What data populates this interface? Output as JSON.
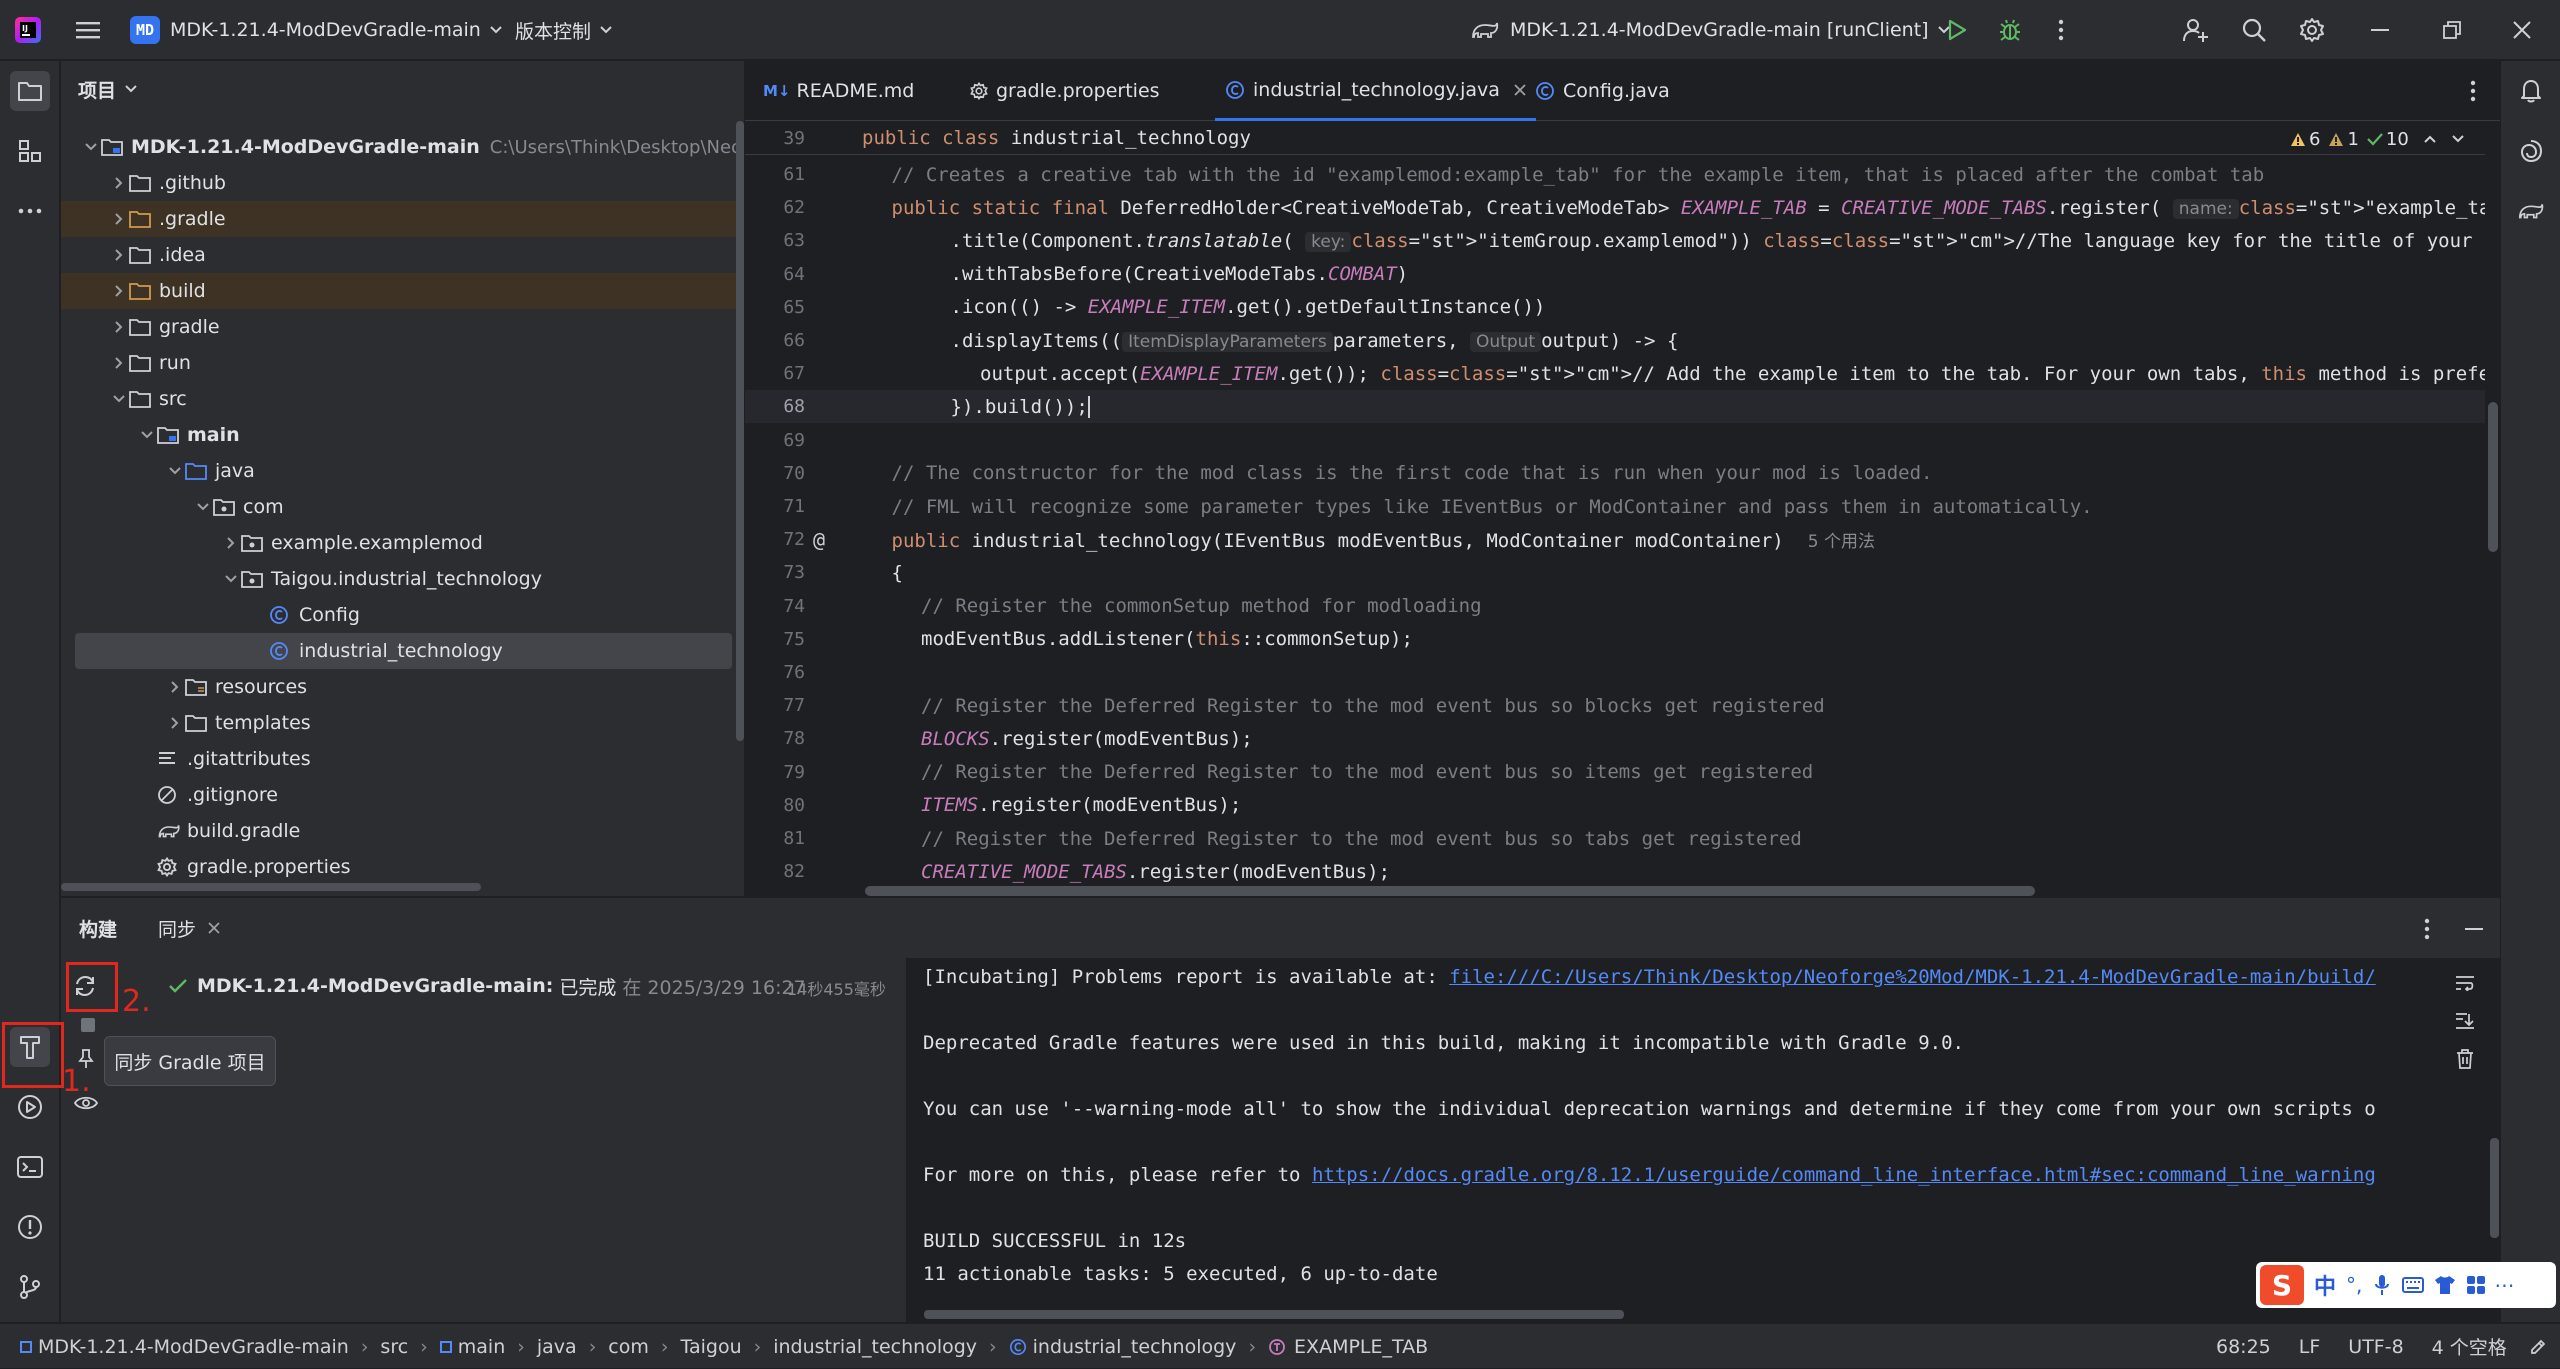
{
  "titlebar": {
    "project_badge": "MD",
    "project_name": "MDK-1.21.4-ModDevGradle-main",
    "vcs_label": "版本控制",
    "run_config": "MDK-1.21.4-ModDevGradle-main [runClient]"
  },
  "project_panel": {
    "header": "项目",
    "root_name": "MDK-1.21.4-ModDevGradle-main",
    "root_path": "C:\\Users\\Think\\Desktop\\Neoforge",
    "items": [
      {
        "label": ".github"
      },
      {
        "label": ".gradle"
      },
      {
        "label": ".idea"
      },
      {
        "label": "build"
      },
      {
        "label": "gradle"
      },
      {
        "label": "run"
      },
      {
        "label": "src"
      },
      {
        "label": "main"
      },
      {
        "label": "java"
      },
      {
        "label": "com"
      },
      {
        "label": "example.examplemod"
      },
      {
        "label": "Taigou.industrial_technology"
      },
      {
        "label": "Config"
      },
      {
        "label": "industrial_technology"
      },
      {
        "label": "resources"
      },
      {
        "label": "templates"
      },
      {
        "label": ".gitattributes"
      },
      {
        "label": ".gitignore"
      },
      {
        "label": "build.gradle"
      },
      {
        "label": "gradle.properties"
      }
    ]
  },
  "editor": {
    "tabs": [
      {
        "label": "README.md",
        "icon": "markdown-icon"
      },
      {
        "label": "gradle.properties",
        "icon": "gear-icon"
      },
      {
        "label": "industrial_technology.java",
        "icon": "class-icon"
      },
      {
        "label": "Config.java",
        "icon": "class-icon"
      }
    ],
    "sticky_line": {
      "num": "39",
      "text": "public class industrial_technology"
    },
    "inspections": {
      "warnings": "6",
      "weak_warnings": "1",
      "ok": "10"
    },
    "lines": [
      {
        "num": "61",
        "text": "// Creates a creative tab with the id \"examplemod:example_tab\" for the example item, that is placed after the combat tab"
      },
      {
        "num": "62",
        "text": "public static final DeferredHolder<CreativeModeTab, CreativeModeTab> EXAMPLE_TAB = CREATIVE_MODE_TABS.register( name: \"example_tab\","
      },
      {
        "num": "63",
        "text": ".title(Component.translatable( key: \"itemGroup.examplemod\")) //The language key for the title of your CreativeModeTab"
      },
      {
        "num": "64",
        "text": ".withTabsBefore(CreativeModeTabs.COMBAT)"
      },
      {
        "num": "65",
        "text": ".icon(() -> EXAMPLE_ITEM.get().getDefaultInstance())"
      },
      {
        "num": "66",
        "text": ".displayItems(( ItemDisplayParameters parameters,  Output output) -> {"
      },
      {
        "num": "67",
        "text": "output.accept(EXAMPLE_ITEM.get()); // Add the example item to the tab. For your own tabs, this method is preferred over t"
      },
      {
        "num": "68",
        "text": "}).build());"
      },
      {
        "num": "69",
        "text": ""
      },
      {
        "num": "70",
        "text": "// The constructor for the mod class is the first code that is run when your mod is loaded."
      },
      {
        "num": "71",
        "text": "// FML will recognize some parameter types like IEventBus or ModContainer and pass them in automatically."
      },
      {
        "num": "72",
        "text": "public industrial_technology(IEventBus modEventBus, ModContainer modContainer)"
      },
      {
        "num": "73",
        "text": "{"
      },
      {
        "num": "74",
        "text": "// Register the commonSetup method for modloading"
      },
      {
        "num": "75",
        "text": "modEventBus.addListener(this::commonSetup);"
      },
      {
        "num": "76",
        "text": ""
      },
      {
        "num": "77",
        "text": "// Register the Deferred Register to the mod event bus so blocks get registered"
      },
      {
        "num": "78",
        "text": "BLOCKS.register(modEventBus);"
      },
      {
        "num": "79",
        "text": "// Register the Deferred Register to the mod event bus so items get registered"
      },
      {
        "num": "80",
        "text": "ITEMS.register(modEventBus);"
      },
      {
        "num": "81",
        "text": "// Register the Deferred Register to the mod event bus so tabs get registered"
      },
      {
        "num": "82",
        "text": "CREATIVE_MODE_TABS.register(modEventBus);"
      }
    ],
    "usage_hint": "5 个用法"
  },
  "build_panel": {
    "tab_build": "构建",
    "tab_sync": "同步",
    "task_name": "MDK-1.21.4-ModDevGradle-main:",
    "task_status": "已完成",
    "task_time": "在 2025/3/29 16:27",
    "task_duration": "14秒455毫秒",
    "tooltip": "同步 Gradle 项目",
    "console": {
      "line1_prefix": "[Incubating] Problems report is available at: ",
      "line1_link": "file:///C:/Users/Think/Desktop/Neoforge%20Mod/MDK-1.21.4-ModDevGradle-main/build/",
      "line2": "Deprecated Gradle features were used in this build, making it incompatible with Gradle 9.0.",
      "line3": "You can use '--warning-mode all' to show the individual deprecation warnings and determine if they come from your own scripts o",
      "line4_prefix": "For more on this, please refer to ",
      "line4_link": "https://docs.gradle.org/8.12.1/userguide/command_line_interface.html#sec:command_line_warning",
      "line5": "BUILD SUCCESSFUL in 12s",
      "line6": "11 actionable tasks: 5 executed, 6 up-to-date"
    }
  },
  "annotations": {
    "num1": "1.",
    "num2": "2."
  },
  "statusbar": {
    "breadcrumbs": [
      "MDK-1.21.4-ModDevGradle-main",
      "src",
      "main",
      "java",
      "com",
      "Taigou",
      "industrial_technology",
      "industrial_technology",
      "EXAMPLE_TAB"
    ],
    "position": "68:25",
    "line_sep": "LF",
    "encoding": "UTF-8",
    "indent": "4 个空格"
  },
  "ime": {
    "lang": "中"
  },
  "colors": {
    "accent": "#3574f0",
    "annotation_red": "#e0281e",
    "success_green": "#5fb865"
  }
}
